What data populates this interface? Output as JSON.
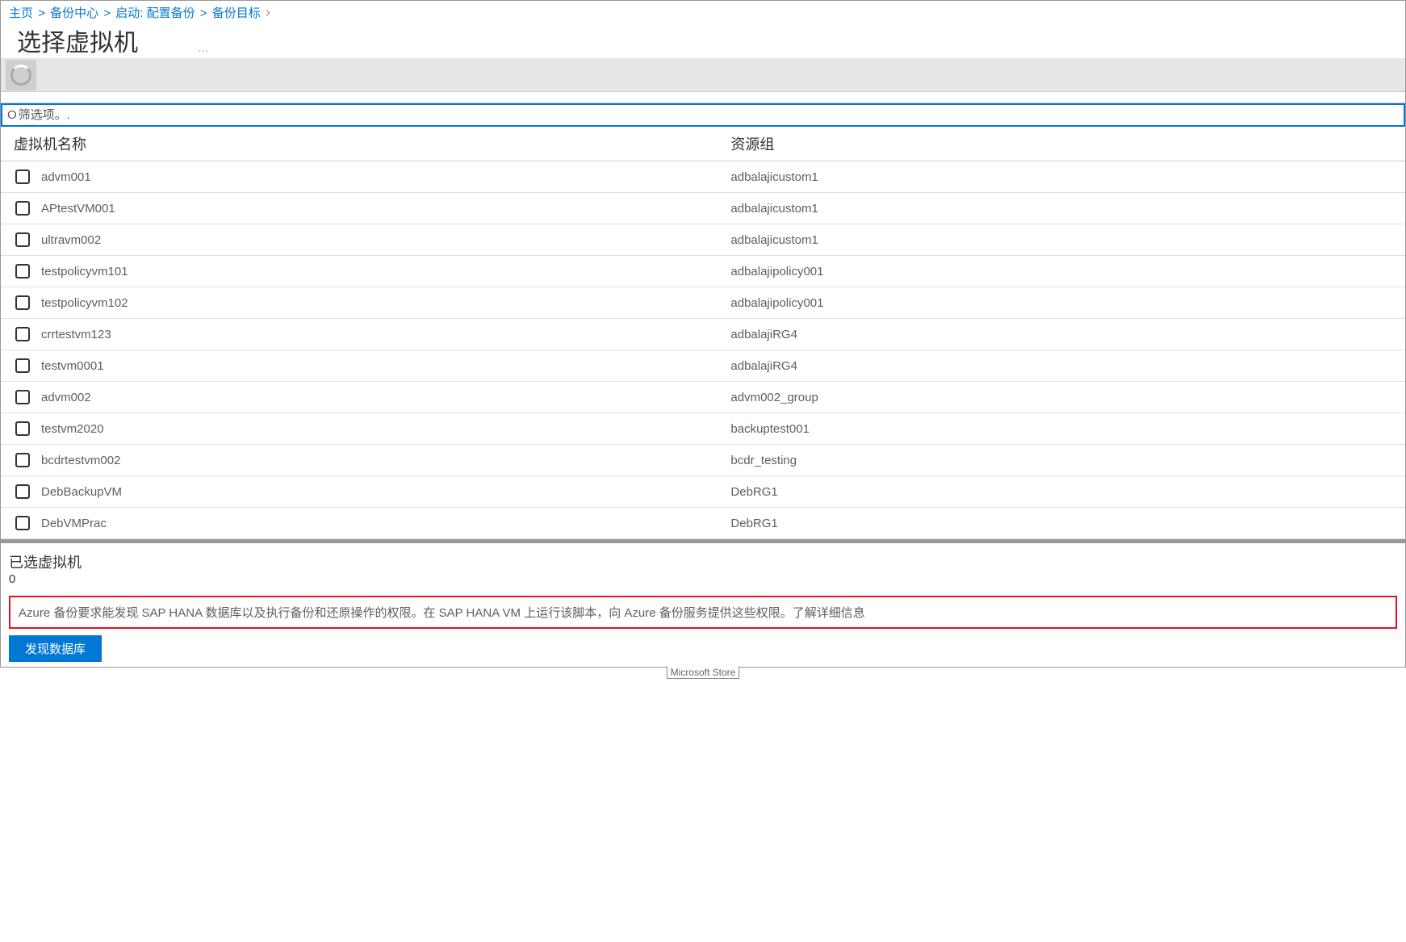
{
  "breadcrumb": {
    "items": [
      {
        "label": "主页"
      },
      {
        "label": "备份中心"
      },
      {
        "label": "启动: 配置备份"
      },
      {
        "label": "备份目标"
      }
    ]
  },
  "header": {
    "title": "选择虚拟机",
    "subtitle": "…"
  },
  "spinner_bar": {
    "text": ""
  },
  "filter": {
    "placeholder": "筛选项。."
  },
  "table": {
    "columns": {
      "name": "虚拟机名称",
      "rg": "资源组"
    },
    "rows": [
      {
        "name": "advm001",
        "rg": "adbalajicustom1"
      },
      {
        "name": "APtestVM001",
        "rg": "adbalajicustom1"
      },
      {
        "name": "ultravm002",
        "rg": "adbalajicustom1"
      },
      {
        "name": "testpolicyvm101",
        "rg": "adbalajipolicy001"
      },
      {
        "name": "testpolicyvm102",
        "rg": "adbalajipolicy001"
      },
      {
        "name": "crrtestvm123",
        "rg": "adbalajiRG4"
      },
      {
        "name": "testvm0001",
        "rg": "adbalajiRG4"
      },
      {
        "name": "advm002",
        "rg": "advm002_group"
      },
      {
        "name": "testvm2020",
        "rg": "backuptest001"
      },
      {
        "name": "bcdrtestvm002",
        "rg": "bcdr_testing"
      },
      {
        "name": "DebBackupVM",
        "rg": "DebRG1"
      },
      {
        "name": "DebVMPrac",
        "rg": "DebRG1"
      }
    ]
  },
  "selected": {
    "title": "已选虚拟机",
    "count": "0"
  },
  "info": {
    "text": "Azure 备份要求能发现 SAP HANA 数据库以及执行备份和还原操作的权限。在 SAP HANA VM 上运行该脚本，向 Azure 备份服务提供这些权限。了解详细信息"
  },
  "actions": {
    "discover_label": "发现数据库"
  },
  "footer": {
    "tag": "Microsoft Store"
  }
}
